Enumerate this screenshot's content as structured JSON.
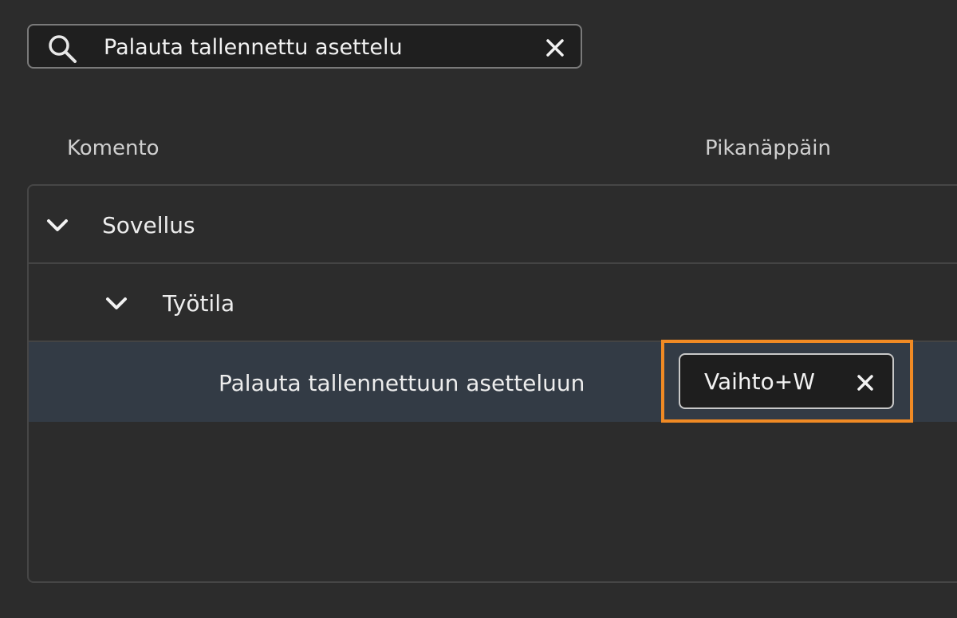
{
  "search": {
    "value": "Palauta tallennettu asettelu",
    "icon": "search-icon",
    "clear_icon": "close-icon"
  },
  "columns": {
    "command": "Komento",
    "shortcut": "Pikanäppäin"
  },
  "tree": {
    "category": {
      "label": "Sovellus",
      "expanded": true
    },
    "subcategory": {
      "label": "Työtila",
      "expanded": true
    },
    "command": {
      "label": "Palauta tallennettuun asetteluun",
      "shortcut": "Vaihto+W",
      "selected": true
    }
  },
  "colors": {
    "background": "#2c2c2c",
    "selected_row": "#333b45",
    "highlight": "#f08a24"
  }
}
